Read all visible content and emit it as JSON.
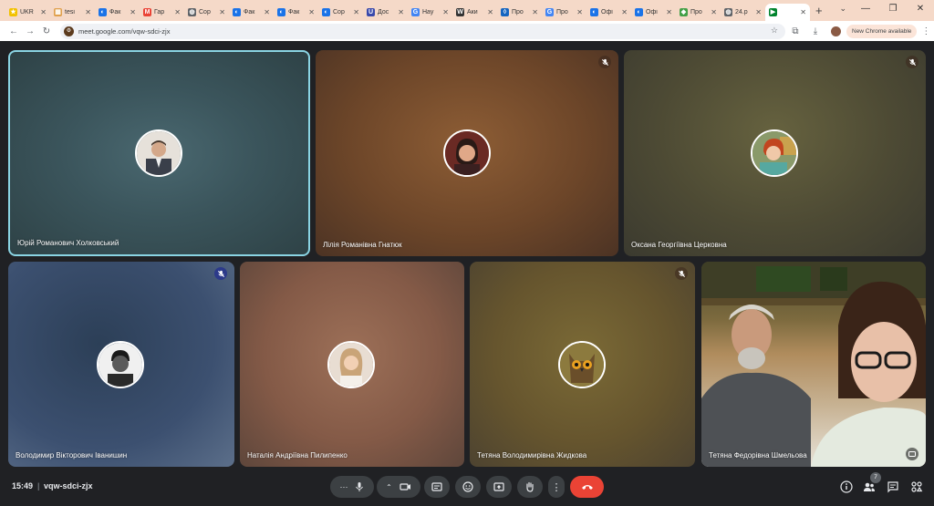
{
  "browser": {
    "tabs": [
      {
        "label": "UKR",
        "color": "#f2c200",
        "glyph": "★"
      },
      {
        "label": "tesi",
        "color": "#e0a04c",
        "glyph": "▦"
      },
      {
        "label": "Фак",
        "color": "#1a73e8",
        "glyph": "◐"
      },
      {
        "label": "Гар",
        "color": "#ea4335",
        "glyph": "M"
      },
      {
        "label": "Сор",
        "color": "#5f6368",
        "glyph": "◍"
      },
      {
        "label": "Фак",
        "color": "#1a73e8",
        "glyph": "◐"
      },
      {
        "label": "Фак",
        "color": "#1a73e8",
        "glyph": "◐"
      },
      {
        "label": "Сор",
        "color": "#1a73e8",
        "glyph": "◐"
      },
      {
        "label": "Дос",
        "color": "#3949ab",
        "glyph": "U"
      },
      {
        "label": "Нау",
        "color": "#4285f4",
        "glyph": "G"
      },
      {
        "label": "Аки",
        "color": "#333333",
        "glyph": "W"
      },
      {
        "label": "Про",
        "color": "#1565c0",
        "glyph": "◊"
      },
      {
        "label": "Про",
        "color": "#4285f4",
        "glyph": "G"
      },
      {
        "label": "Офі",
        "color": "#1a73e8",
        "glyph": "◐"
      },
      {
        "label": "Офі",
        "color": "#1a73e8",
        "glyph": "◐"
      },
      {
        "label": "Про",
        "color": "#43a047",
        "glyph": "◆"
      },
      {
        "label": "24.р",
        "color": "#5f6368",
        "glyph": "◍"
      },
      {
        "label": "",
        "color": "#00832d",
        "glyph": "▶"
      }
    ],
    "address": "meet.google.com/vqw-sdci-zjx",
    "new_chrome_label": "New Chrome available"
  },
  "participants": [
    {
      "name": "Юрій Романович Холковський",
      "avatar_color": "#e9e4de",
      "muted": false
    },
    {
      "name": "Лілія Романівна Гнатюк",
      "avatar_color": "#7a2e2a",
      "muted": true
    },
    {
      "name": "Оксана Георгіївна Церковна",
      "avatar_color": "#c98b55",
      "muted": true
    },
    {
      "name": "Володимир Вікторович Іванишин",
      "avatar_color": "#3c3c3c",
      "muted": true
    },
    {
      "name": "Наталія Андріївна Пилипенко",
      "avatar_color": "#dcc8b4",
      "muted": false
    },
    {
      "name": "Тетяна Володимирівна Жидкова",
      "avatar_color": "#7a6a3a",
      "muted": true
    },
    {
      "name": "Тетяна Федорівна Шмельова",
      "avatar_color": "",
      "muted": false
    }
  ],
  "meeting": {
    "time": "15:49",
    "separator": "|",
    "code": "vqw-sdci-zjx",
    "participant_count": "7"
  }
}
